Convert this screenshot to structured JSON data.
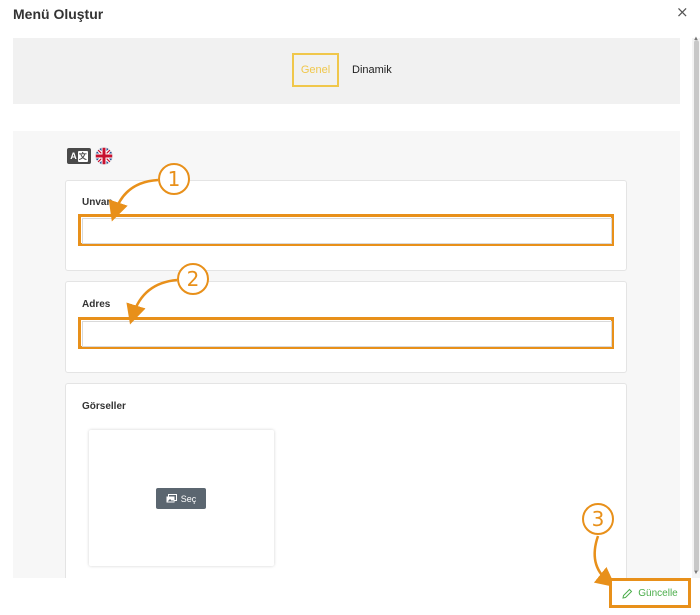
{
  "modal": {
    "title": "Menü Oluştur",
    "close_glyph": "×"
  },
  "tabs": [
    {
      "label": "Genel",
      "active": true
    },
    {
      "label": "Dinamik",
      "active": false
    }
  ],
  "language_switcher": {
    "translate_icon": "translate-icon",
    "translate_glyph_a": "A",
    "translate_glyph_b": "文",
    "flag_icon": "uk-flag-icon"
  },
  "fields": {
    "unvan": {
      "label": "Unvan",
      "value": "",
      "placeholder": ""
    },
    "adres": {
      "label": "Adres",
      "value": "",
      "placeholder": ""
    },
    "gorseller": {
      "label": "Görseller",
      "select_button": "Seç",
      "select_icon": "images-icon"
    }
  },
  "annotations": {
    "one": "1",
    "two": "2",
    "three": "3"
  },
  "footer": {
    "update_button": "Güncelle",
    "update_icon": "pencil-icon"
  },
  "colors": {
    "accent": "#e8901a",
    "active_tab": "#f0c74b",
    "update_text": "#4cae4c",
    "select_button_bg": "#5b6670"
  }
}
